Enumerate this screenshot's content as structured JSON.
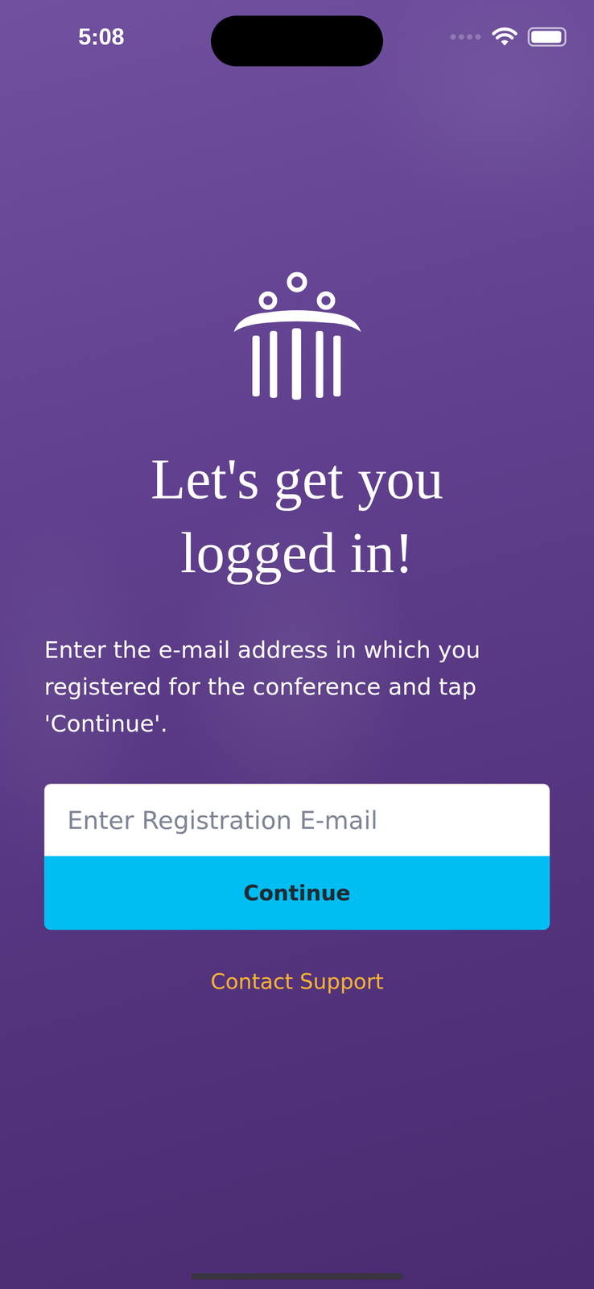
{
  "status_bar": {
    "time": "5:08",
    "battery_level": 0.95
  },
  "title": "Let's get you logged in!",
  "instructions": "Enter the e-mail address in which you registered for the conference and tap 'Continue'.",
  "email_field": {
    "placeholder": "Enter Registration E-mail"
  },
  "continue_button": "Continue",
  "support_link": "Contact Support"
}
